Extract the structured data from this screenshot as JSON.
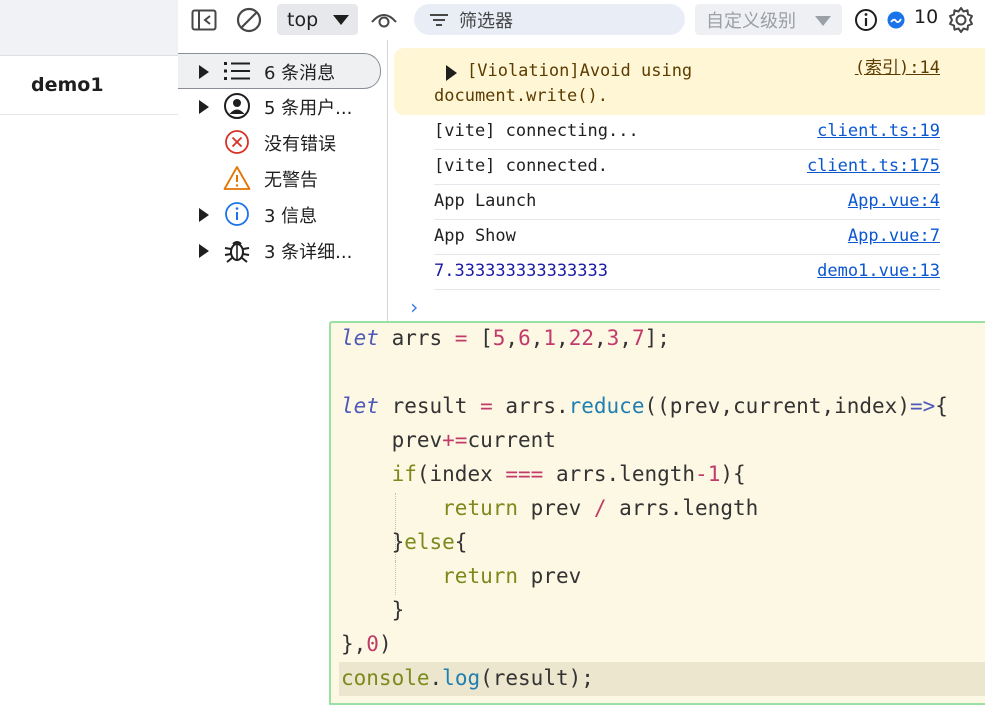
{
  "app": {
    "page_title": "demo1"
  },
  "toolbar": {
    "context": "top",
    "filter_placeholder": "筛选器",
    "levels": "自定义级别",
    "issue_count": "10",
    "icons": [
      "dock-side-icon",
      "clear-console-icon",
      "eye-icon",
      "filter-icon",
      "info-icon",
      "issues-icon",
      "gear-icon"
    ]
  },
  "sidebar": {
    "items": [
      {
        "label": "6 条消息",
        "icon": "list-icon",
        "expandable": true,
        "selected": true
      },
      {
        "label": "5 条用户...",
        "icon": "user-icon",
        "expandable": true
      },
      {
        "label": "没有错误",
        "icon": "error-icon",
        "expandable": false
      },
      {
        "label": "无警告",
        "icon": "warning-icon",
        "expandable": false
      },
      {
        "label": "3 信息",
        "icon": "info-icon",
        "expandable": true
      },
      {
        "label": "3 条详细...",
        "icon": "bug-icon",
        "expandable": true
      }
    ]
  },
  "console": {
    "violation": {
      "line1": "[Violation]Avoid using",
      "line2": "document.write().",
      "source": "(索引):14"
    },
    "logs": [
      {
        "message": "[vite] connecting...",
        "source": "client.ts:19"
      },
      {
        "message": "[vite] connected.",
        "source": "client.ts:175"
      },
      {
        "message": "App Launch",
        "source": "App.vue:4"
      },
      {
        "message": "App Show",
        "source": "App.vue:7"
      },
      {
        "message": "7.333333333333333",
        "source": "demo1.vue:13",
        "numeric": true
      }
    ],
    "prompt": "›"
  },
  "code": {
    "lines": [
      "let arrs = [5,6,1,22,3,7];",
      "",
      "let result = arrs.reduce((prev,current,index)=>{",
      "    prev+=current",
      "    if(index === arrs.length-1){",
      "        return prev / arrs.length",
      "    }else{",
      "        return prev",
      "    }",
      "},0)",
      "console.log(result);"
    ]
  },
  "colors": {
    "violation_bg": "#fef6d5",
    "link": "#0b57d0",
    "code_bg": "#fdf8e4",
    "code_border": "#9be0a3",
    "keyword": "#7a8a1b",
    "number": "#c23a6a",
    "function": "#1f7fb0"
  }
}
